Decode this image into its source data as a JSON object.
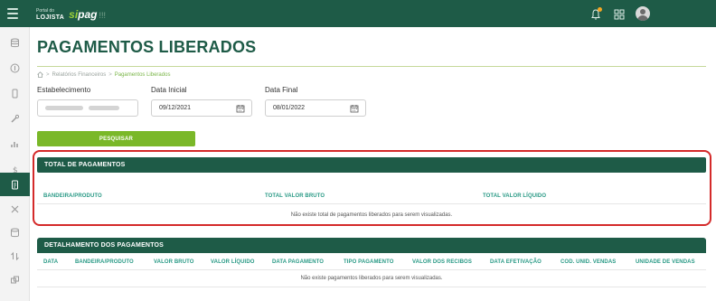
{
  "topbar": {
    "logo_line1": "Portal do",
    "logo_line2": "LOJISTA",
    "brand_sip": "si",
    "brand_ag": "pag",
    "brand_suffix": "!!!"
  },
  "page": {
    "title": "PAGAMENTOS LIBERADOS"
  },
  "breadcrumb": {
    "parent": "Relatórios Financeiros",
    "current": "Pagamentos Liberados"
  },
  "filters": {
    "establishment_label": "Estabelecimento",
    "start_label": "Data Inicial",
    "start_value": "09/12/2021",
    "end_label": "Data Final",
    "end_value": "08/01/2022",
    "search_button": "PESQUISAR"
  },
  "totals": {
    "title": "TOTAL DE PAGAMENTOS",
    "columns": [
      "BANDEIRA/PRODUTO",
      "TOTAL VALOR BRUTO",
      "TOTAL VALOR LÍQUIDO"
    ],
    "empty_message": "Não existe total de pagamentos liberados para serem visualizadas."
  },
  "details": {
    "title": "DETALHAMENTO DOS PAGAMENTOS",
    "columns": [
      "DATA",
      "BANDEIRA/PRODUTO",
      "VALOR BRUTO",
      "VALOR LÍQUIDO",
      "DATA PAGAMENTO",
      "TIPO PAGAMENTO",
      "VALOR DOS RECIBOS",
      "DATA EFETIVAÇÃO",
      "COD. UNID. VENDAS",
      "UNIDADE DE VENDAS"
    ],
    "empty_message": "Não existe pagamentos liberados para serem visualizadas."
  },
  "colors": {
    "primary": "#1e5b47",
    "accent": "#7ab829",
    "highlight": "#d42a2a",
    "column_header": "#2a9a86"
  },
  "icons": [
    "menu-icon",
    "bell-icon",
    "apps-grid-icon",
    "user-avatar",
    "home-icon",
    "calendar-icon"
  ]
}
